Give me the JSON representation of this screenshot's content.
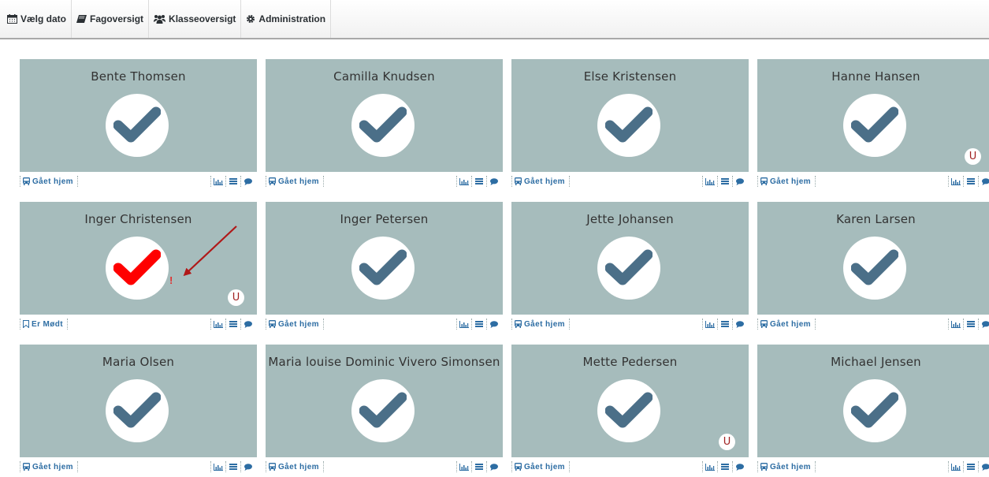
{
  "nav": [
    {
      "label": "Vælg dato",
      "icon": "calendar-icon"
    },
    {
      "label": "Fagoversigt",
      "icon": "book-icon"
    },
    {
      "label": "Klasseoversigt",
      "icon": "users-icon"
    },
    {
      "label": "Administration",
      "icon": "gear-icon"
    }
  ],
  "colors": {
    "tile": "#a6bcbc",
    "check": "#4b6f88",
    "check_alert": "#ff0000",
    "status_link": "#2d6da3",
    "badge_text": "#a02020"
  },
  "students": [
    {
      "name": "Bente Thomsen",
      "status": "Gået hjem",
      "status_icon": "bus-icon",
      "check": "normal",
      "badge": ""
    },
    {
      "name": "Camilla Knudsen",
      "status": "Gået hjem",
      "status_icon": "bus-icon",
      "check": "normal",
      "badge": ""
    },
    {
      "name": "Else Kristensen",
      "status": "Gået hjem",
      "status_icon": "bus-icon",
      "check": "normal",
      "badge": ""
    },
    {
      "name": "Hanne Hansen",
      "status": "Gået hjem",
      "status_icon": "bus-icon",
      "check": "normal",
      "badge": "U"
    },
    {
      "name": "Inger Christensen",
      "status": "Er Mødt",
      "status_icon": "bookmark-icon",
      "check": "alert",
      "badge": "U",
      "alert_mark": "!"
    },
    {
      "name": "Inger Petersen",
      "status": "Gået hjem",
      "status_icon": "bus-icon",
      "check": "normal",
      "badge": ""
    },
    {
      "name": "Jette Johansen",
      "status": "Gået hjem",
      "status_icon": "bus-icon",
      "check": "normal",
      "badge": ""
    },
    {
      "name": "Karen Larsen",
      "status": "Gået hjem",
      "status_icon": "bus-icon",
      "check": "normal",
      "badge": ""
    },
    {
      "name": "Maria Olsen",
      "status": "Gået hjem",
      "status_icon": "bus-icon",
      "check": "normal",
      "badge": ""
    },
    {
      "name": "Maria louise Dominic Vivero  Simonsen",
      "status": "Gået hjem",
      "status_icon": "bus-icon",
      "check": "normal",
      "badge": ""
    },
    {
      "name": "Mette Pedersen",
      "status": "Gået hjem",
      "status_icon": "bus-icon",
      "check": "normal",
      "badge": "U"
    },
    {
      "name": "Michael Jensen",
      "status": "Gået hjem",
      "status_icon": "bus-icon",
      "check": "normal",
      "badge": ""
    }
  ],
  "card_actions": [
    "chart-icon",
    "list-icon",
    "comment-icon"
  ]
}
